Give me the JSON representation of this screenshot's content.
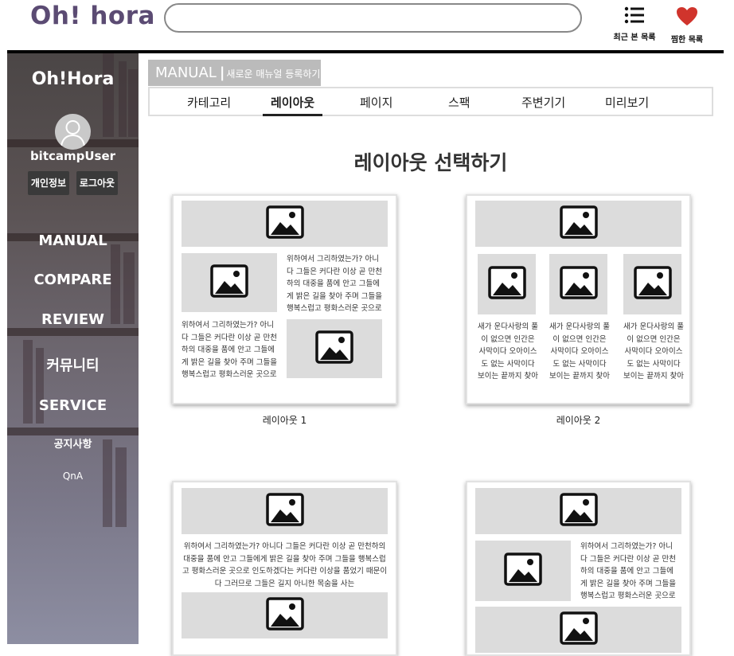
{
  "header": {
    "logo": "Oh! hora",
    "search_placeholder": "",
    "recent_label": "최근 본 목록",
    "recent_icon": "list-icon",
    "fav_label": "찜한 목록",
    "fav_icon": "heart-icon",
    "fav_color": "#d0342c"
  },
  "sidebar": {
    "brand": "Oh!Hora",
    "username": "bitcampUser",
    "profile_button": "개인정보",
    "logout_button": "로그아웃",
    "menu": [
      "MANUAL",
      "COMPARE",
      "REVIEW",
      "커뮤니티",
      "SERVICE"
    ],
    "submenu": [
      "공지사항",
      "QnA"
    ]
  },
  "main": {
    "section_title": "MANUAL",
    "section_subtitle": "새로운 매뉴얼 등록하기",
    "tabs": [
      "카테고리",
      "레이아웃",
      "페이지",
      "스팩",
      "주변기기",
      "미리보기"
    ],
    "active_tab": "레이아웃",
    "heading": "레이아웃 선택하기",
    "layouts": [
      {
        "label": "레이아웃 1",
        "text_a": "위하여서 그리하였는가? 아니다 그들은 커다란 이상 곧 만천하의 대중을 품에 안고 그들에게 밝은 길을 찾아 주며 그들을 행복스럽고 평화스러운 곳으로 인도하겠다는 커다란",
        "text_b": "위하여서 그리하였는가? 아니다 그들은 커다란 이상 곧 만천하의 대중을 품에 안고 그들에게 밝은 길을 찾아 주며 그들을 행복스럽고 평화스러운 곳으로 인도하겠다는 커다란"
      },
      {
        "label": "레이아웃 2",
        "columns": [
          "새가 운다사랑의 풀이 없으면 인간은 사막이다 오아이스도 없는 사막이다 보이는 끝까지 찾아다녀도 목",
          "새가 운다사랑의 풀이 없으면 인간은 사막이다 오아이스도 없는 사막이다 보이는 끝까지 찾아다녀도 목",
          "새가 운다사랑의 풀이 없으면 인간은 사막이다 오아이스도 없는 사막이다 보이는 끝까지 찾아다녀도 목"
        ]
      },
      {
        "label": "",
        "text_a": "위하여서 그리하였는가? 아니다 그들은 커다란 이상 곧 만천하의 대중을 품에 안고 그들에게 밝은 길을 찾아 주며 그들을 행복스럽고 평화스러운 곳으로 인도하겠다는 커다란 이상을 품었기 때문이다 그러므로 그들은 길지 아니한 목숨을 사는"
      },
      {
        "label": "",
        "text_a": "위하여서 그리하였는가? 아니다 그들은 커다란 이상 곧 만천하의 대중을 품에 안고 그들에게 밝은 길을 찾아 주며 그들을 행복스럽고 평화스러운 곳으로 인도하겠다는 커다란"
      }
    ],
    "image_icon": "image-icon"
  }
}
